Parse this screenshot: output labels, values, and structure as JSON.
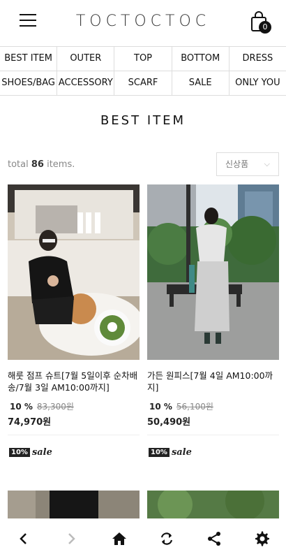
{
  "header": {
    "logo": "TOCTOCTOC",
    "cart_count": "0"
  },
  "categories": [
    [
      "BEST ITEM",
      "OUTER",
      "TOP",
      "BOTTOM",
      "DRESS"
    ],
    [
      "SHOES/BAG",
      "ACCESSORY",
      "SCARF",
      "SALE",
      "ONLY YOU"
    ]
  ],
  "section_title": "BEST ITEM",
  "listing": {
    "total_prefix": "total ",
    "total_count": "86",
    "total_suffix": " items.",
    "sort_selected": "신상품"
  },
  "products": [
    {
      "name": "해룻 점프 슈트[7월 5일이후 순차배송/7월 3일 AM10:00까지]",
      "discount": "10 %",
      "original_price": "83,300원",
      "final_price": "74,970원"
    },
    {
      "name": "가든 원피스[7월 4일 AM10:00까지]",
      "discount": "10 %",
      "original_price": "56,100원",
      "final_price": "50,490원"
    }
  ],
  "sale_badge": {
    "box": "10%",
    "script": "sale"
  },
  "bottom_nav": [
    "back",
    "forward",
    "home",
    "refresh",
    "share",
    "settings"
  ]
}
